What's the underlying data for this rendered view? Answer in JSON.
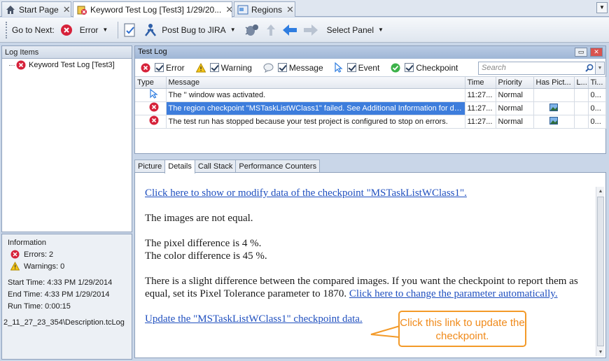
{
  "tabs": [
    {
      "label": "Start Page",
      "icon": "home-icon"
    },
    {
      "label": "Keyword Test Log [Test3]   1/29/20...",
      "icon": "keyword-log-icon"
    },
    {
      "label": "Regions",
      "icon": "regions-icon"
    }
  ],
  "toolbar": {
    "go_to_next": "Go to Next:",
    "error": "Error",
    "post_bug": "Post Bug to JIRA",
    "select_panel": "Select Panel"
  },
  "left": {
    "header": "Log Items",
    "tree_item": "Keyword Test Log [Test3]"
  },
  "info": {
    "title": "Information",
    "errors": "Errors: 2",
    "warnings": "Warnings: 0",
    "start_time": "Start Time: 4:33 PM 1/29/2014",
    "end_time": "End Time: 4:33 PM 1/29/2014",
    "run_time": "Run Time: 0:00:15",
    "file": "2_11_27_23_354\\Description.tcLog"
  },
  "log": {
    "title": "Test Log",
    "filters": {
      "error": "Error",
      "warning": "Warning",
      "message": "Message",
      "event": "Event",
      "checkpoint": "Checkpoint"
    },
    "search_placeholder": "Search",
    "columns": {
      "type": "Type",
      "message": "Message",
      "time": "Time",
      "priority": "Priority",
      "has_picture": "Has Pict...",
      "link": "L...",
      "ti": "Ti..."
    },
    "rows": [
      {
        "type": "event",
        "message": "The '' window was activated.",
        "time": "11:27...",
        "priority": "Normal",
        "has_picture": false,
        "ti": "0..."
      },
      {
        "type": "error",
        "message": "The region checkpoint \"MSTaskListWClass1\" failed. See Additional Information for det...",
        "time": "11:27...",
        "priority": "Normal",
        "has_picture": true,
        "ti": "0..."
      },
      {
        "type": "error",
        "message": "The test run has stopped because your test project is configured to stop on errors.",
        "time": "11:27...",
        "priority": "Normal",
        "has_picture": true,
        "ti": "0..."
      }
    ]
  },
  "details_tabs": [
    "Picture",
    "Details",
    "Call Stack",
    "Performance Counters"
  ],
  "details": {
    "link1": "Click here to show or modify data of the checkpoint \"MSTaskListWClass1\".",
    "line1": "The images are not equal.",
    "line2": "The pixel difference is 4 %.",
    "line3": "The color difference is 45 %.",
    "line4": "There is a slight difference between the compared images. If you want the checkpoint to report them as equal, set its Pixel Tolerance parameter to 1870.",
    "link2": "Click here to change the parameter automatically.",
    "link3": "Update the \"MSTaskListWClass1\" checkpoint data."
  },
  "callout": "Click this link to update the checkpoint.",
  "colors": {
    "accent": "#3d7ddc",
    "callout": "#f39a29",
    "error": "#d6223a"
  }
}
